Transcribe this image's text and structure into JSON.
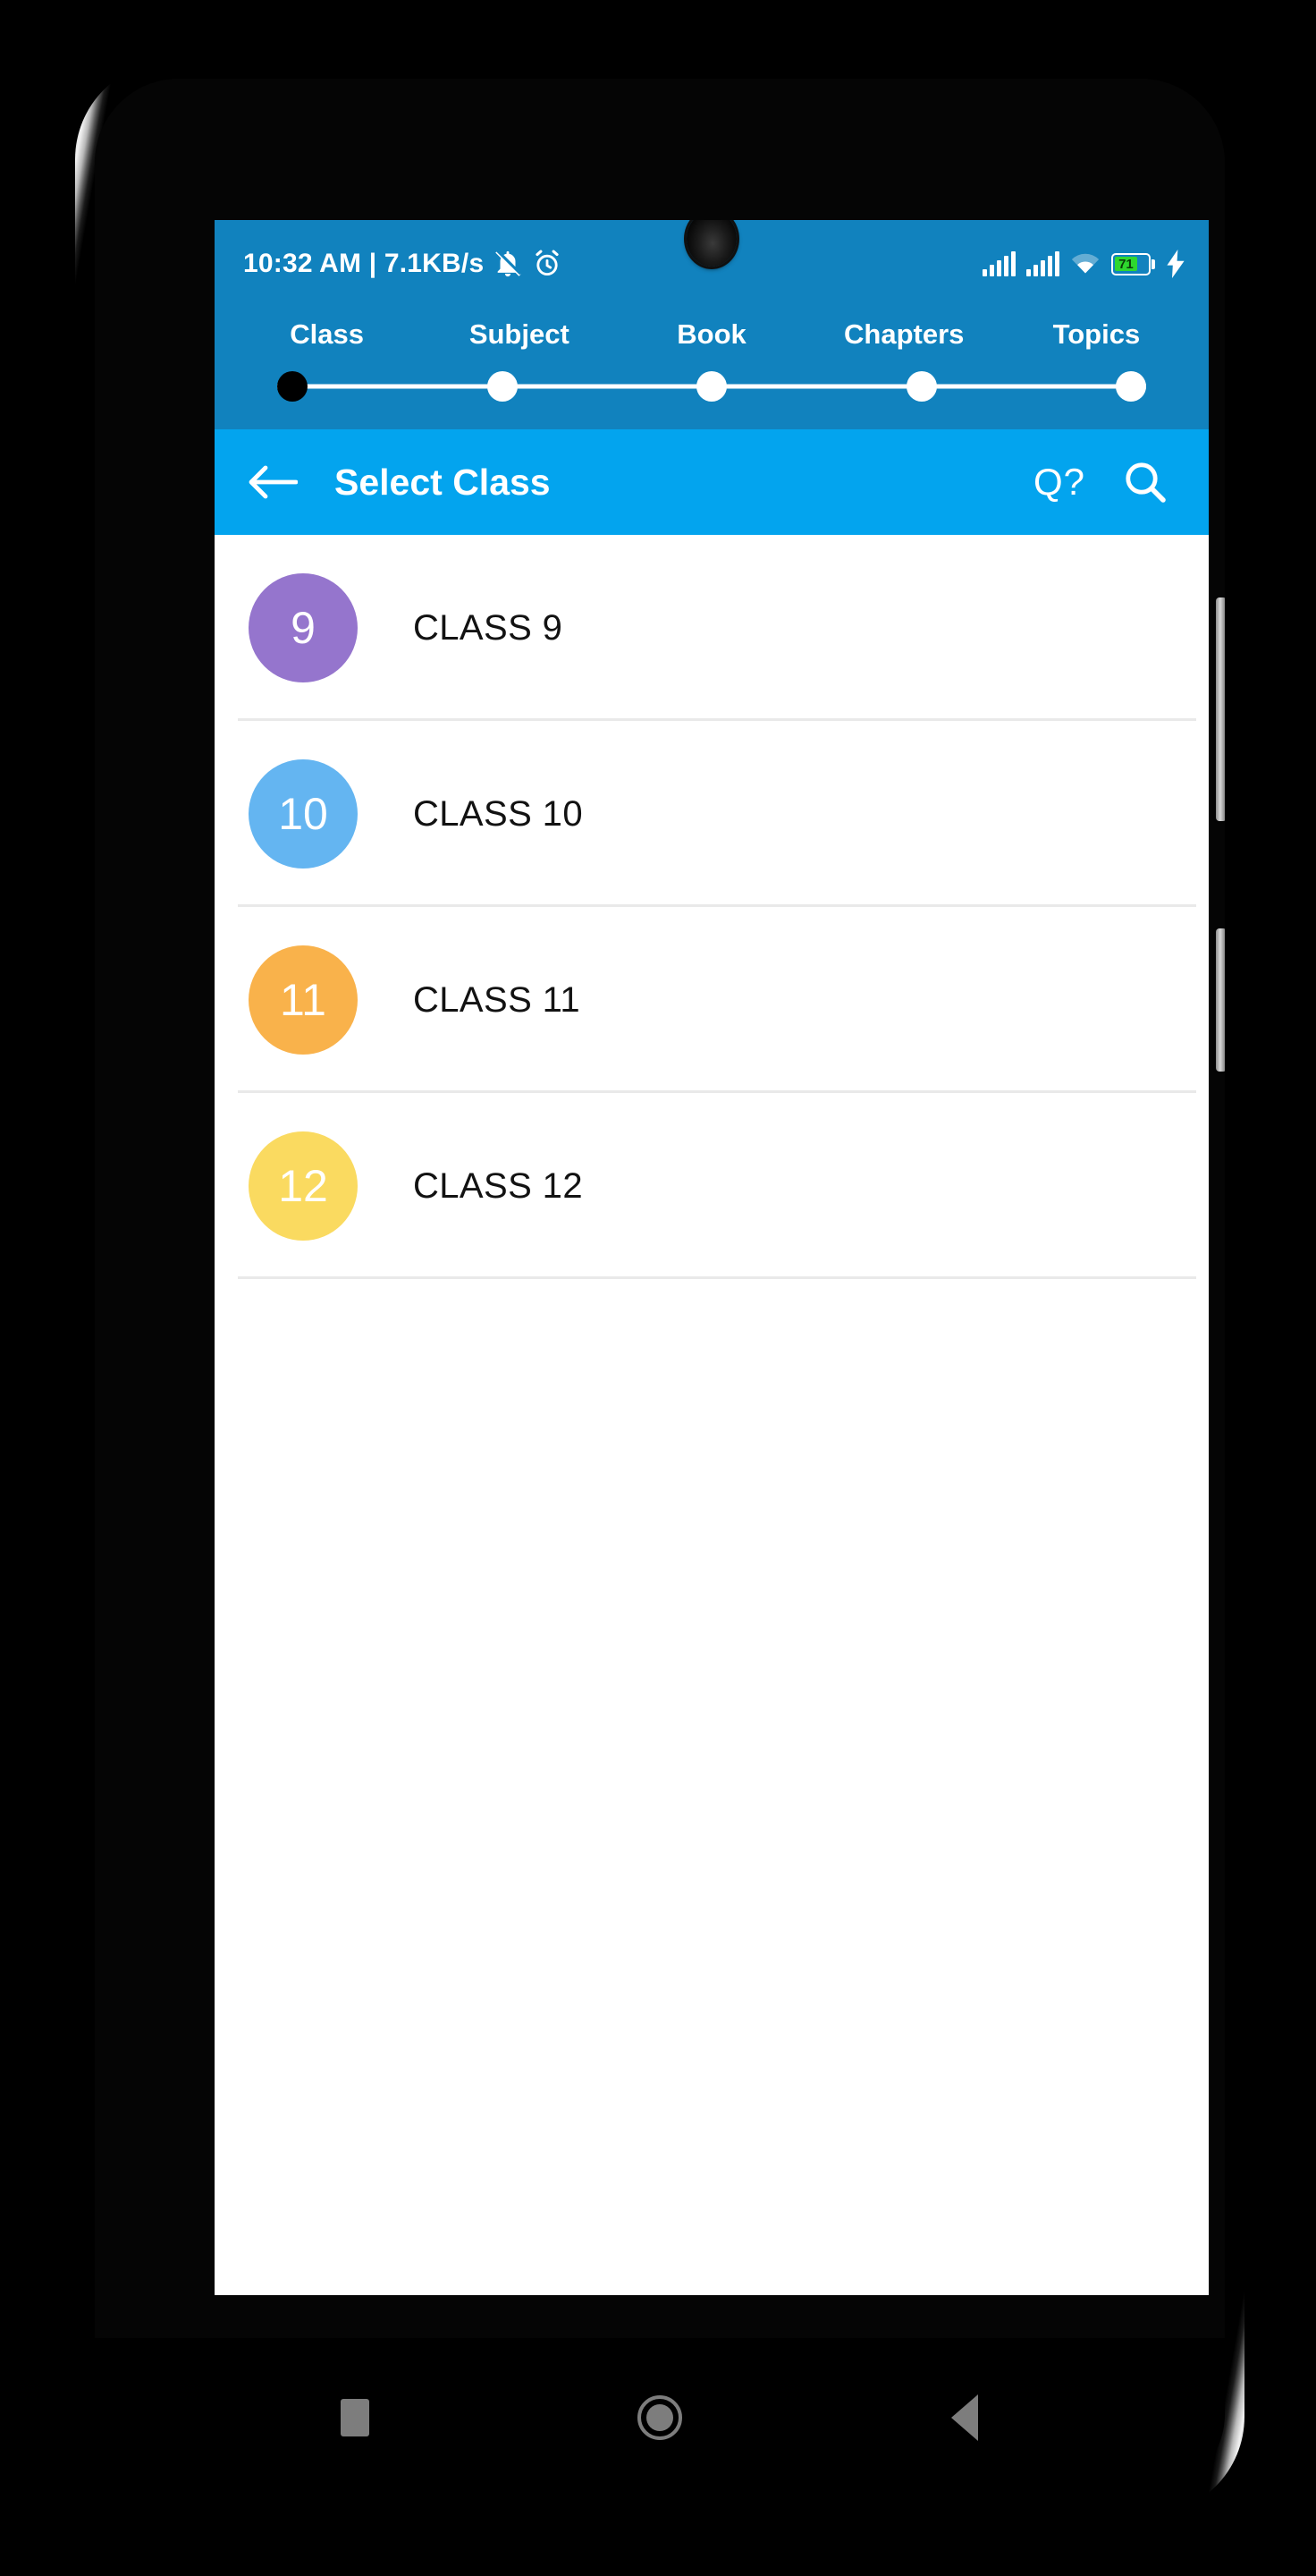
{
  "status_bar": {
    "text": "10:32 AM | 7.1KB/s",
    "mute_icon": "bell-mute-icon",
    "alarm_icon": "alarm-clock-icon",
    "signal_icon_1": "signal-bars-icon",
    "signal_icon_2": "signal-bars-icon",
    "wifi_icon": "wifi-icon",
    "battery_level": "71",
    "charging_icon": "charging-bolt-icon"
  },
  "stepper": {
    "steps": [
      {
        "label": "Class",
        "state": "active"
      },
      {
        "label": "Subject",
        "state": "pending"
      },
      {
        "label": "Book",
        "state": "pending"
      },
      {
        "label": "Chapters",
        "state": "pending"
      },
      {
        "label": "Topics",
        "state": "pending"
      }
    ]
  },
  "app_bar": {
    "back_icon": "arrow-left-icon",
    "title": "Select Class",
    "qa_label": "Q?",
    "search_icon": "search-icon"
  },
  "class_list": [
    {
      "badge": "9",
      "label": "CLASS 9",
      "color": "#9575cd"
    },
    {
      "badge": "10",
      "label": "CLASS 10",
      "color": "#64b5f1"
    },
    {
      "badge": "11",
      "label": "CLASS 11",
      "color": "#f9b24b"
    },
    {
      "badge": "12",
      "label": "CLASS 12",
      "color": "#fad košt"
    }
  ],
  "nav_bar": {
    "recents_label": "recents-square-icon",
    "home_label": "home-circle-icon",
    "back_label": "back-triangle-icon"
  },
  "colors": {
    "status_bar_blue": "#1182BE",
    "stepper_blue": "#1182BE",
    "app_bar_blue": "#03A4EE",
    "divider": "#e9e9e9",
    "text_dark": "#121212",
    "battery_green": "#2ed72e"
  }
}
